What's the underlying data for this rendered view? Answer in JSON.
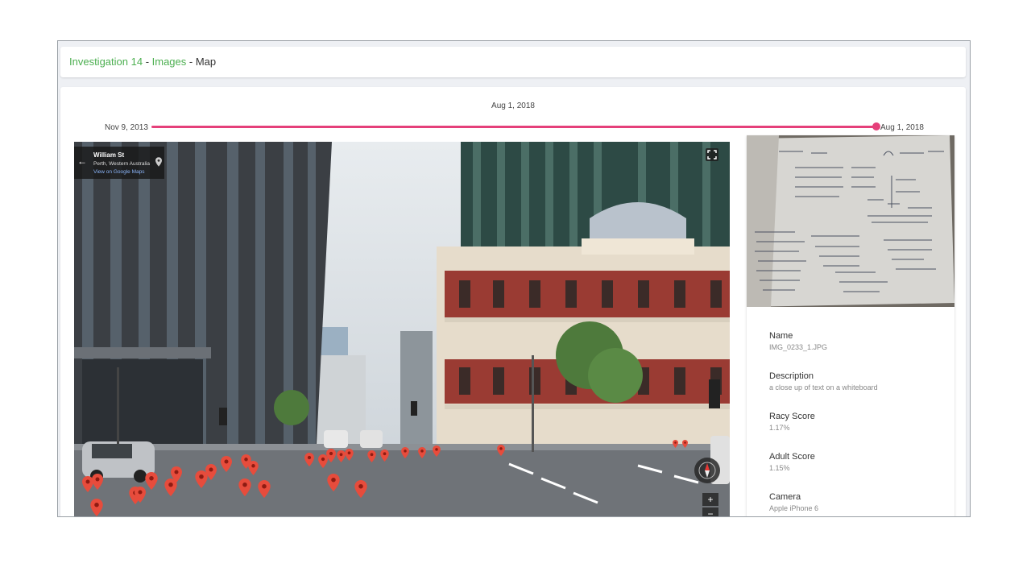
{
  "breadcrumb": {
    "investigation": "Investigation 14",
    "sep1": " - ",
    "images": "Images",
    "sep2": " - ",
    "current": "Map"
  },
  "timeline": {
    "current_date": "Aug 1, 2018",
    "start_date": "Nov 9, 2013",
    "end_date": "Aug 1, 2018",
    "accent_color": "#e5407a"
  },
  "street_view": {
    "street": "William St",
    "city": "Perth, Western Australia",
    "link": "View on Google Maps",
    "zoom_in": "+",
    "zoom_out": "−",
    "pin_color": "#e74c3c"
  },
  "details": {
    "name_label": "Name",
    "name_value": "IMG_0233_1.JPG",
    "description_label": "Description",
    "description_value": "a close up of text on a whiteboard",
    "racy_label": "Racy Score",
    "racy_value": "1.17%",
    "adult_label": "Adult Score",
    "adult_value": "1.15%",
    "camera_label": "Camera",
    "camera_value": "Apple iPhone 6"
  },
  "brand_color": "#4caf50"
}
